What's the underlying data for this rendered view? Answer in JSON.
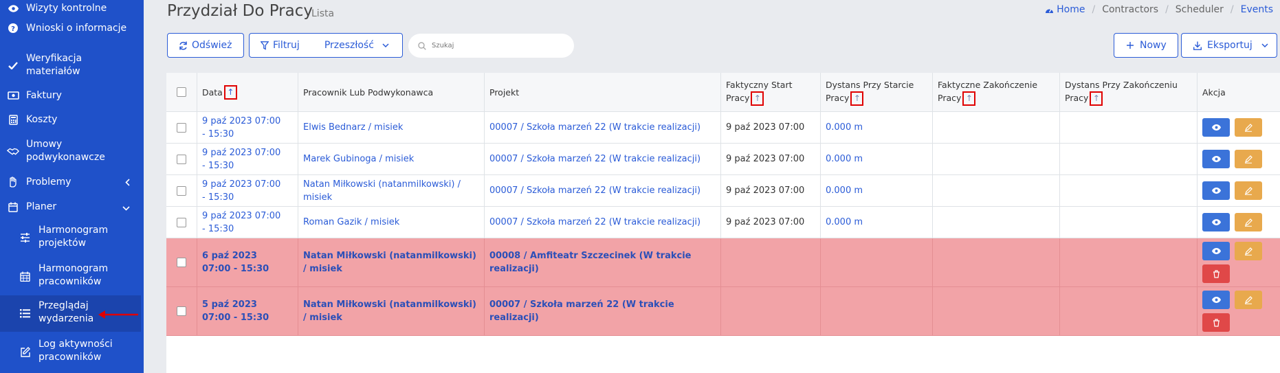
{
  "sidebar": {
    "items": [
      {
        "label": "Wizyty kontrolne",
        "icon": "eye-icon"
      },
      {
        "label": "Wnioski o informacje",
        "icon": "question-circle-icon"
      },
      {
        "label": "Weryfikacja materiałów",
        "icon": "check-icon"
      },
      {
        "label": "Faktury",
        "icon": "money-bill-icon"
      },
      {
        "label": "Koszty",
        "icon": "calculator-icon"
      },
      {
        "label": "Umowy podwykonawcze",
        "icon": "handshake-icon"
      },
      {
        "label": "Problemy",
        "icon": "hand-icon"
      },
      {
        "label": "Planer",
        "icon": "calendar-icon"
      },
      {
        "label": "Harmonogram projektów",
        "icon": "sliders-icon"
      },
      {
        "label": "Harmonogram pracowników",
        "icon": "calendar-grid-icon"
      },
      {
        "label": "Przeglądaj wydarzenia",
        "icon": "list-icon"
      },
      {
        "label": "Log aktywności pracowników",
        "icon": "edit-icon"
      }
    ]
  },
  "header": {
    "title": "Przydział Do Pracy",
    "subtitle": "Lista",
    "breadcrumbs": [
      "Home",
      "Contractors",
      "Scheduler",
      "Events"
    ]
  },
  "toolbar": {
    "refresh": "Odśwież",
    "filter": "Filtruj",
    "period": "Przeszłość",
    "search_placeholder": "Szukaj",
    "new": "Nowy",
    "export": "Eksportuj"
  },
  "table": {
    "columns": {
      "date": "Data",
      "worker": "Pracownik Lub Podwykonawca",
      "project": "Projekt",
      "actual_start": "Faktyczny Start Pracy",
      "start_distance": "Dystans Przy Starcie Pracy",
      "actual_end": "Faktyczne Zakończenie Pracy",
      "end_distance": "Dystans Przy Zakończeniu Pracy",
      "action": "Akcja"
    },
    "rows": [
      {
        "date": "9 paź 2023 07:00 - 15:30",
        "worker": "Elwis Bednarz / misiek",
        "project": "00007 / Szkoła marzeń 22 (W trakcie realizacji)",
        "actual_start": "9 paź 2023 07:00",
        "start_distance": "0.000 m",
        "actual_end": "",
        "end_distance": ""
      },
      {
        "date": "9 paź 2023 07:00 - 15:30",
        "worker": "Marek Gubinoga / misiek",
        "project": "00007 / Szkoła marzeń 22 (W trakcie realizacji)",
        "actual_start": "9 paź 2023 07:00",
        "start_distance": "0.000 m",
        "actual_end": "",
        "end_distance": ""
      },
      {
        "date": "9 paź 2023 07:00 - 15:30",
        "worker": "Natan Miłkowski (natanmilkowski) / misiek",
        "project": "00007 / Szkoła marzeń 22 (W trakcie realizacji)",
        "actual_start": "9 paź 2023 07:00",
        "start_distance": "0.000 m",
        "actual_end": "",
        "end_distance": ""
      },
      {
        "date": "9 paź 2023 07:00 - 15:30",
        "worker": "Roman Gazik / misiek",
        "project": "00007 / Szkoła marzeń 22 (W trakcie realizacji)",
        "actual_start": "9 paź 2023 07:00",
        "start_distance": "0.000 m",
        "actual_end": "",
        "end_distance": ""
      },
      {
        "date": "6 paź 2023 07:00 - 15:30",
        "worker": "Natan Miłkowski (natanmilkowski) / misiek",
        "project": "00008 / Amfiteatr Szczecinek (W trakcie realizacji)",
        "actual_start": "",
        "start_distance": "",
        "actual_end": "",
        "end_distance": ""
      },
      {
        "date": "5 paź 2023 07:00 - 15:30",
        "worker": "Natan Miłkowski (natanmilkowski) / misiek",
        "project": "00007 / Szkoła marzeń 22 (W trakcie realizacji)",
        "actual_start": "",
        "start_distance": "",
        "actual_end": "",
        "end_distance": ""
      }
    ]
  },
  "colors": {
    "sidebar": "#1f51c9",
    "primary": "#2a5bd7",
    "danger_row": "#f2a3a7",
    "view_button": "#3b73d9",
    "edit_button": "#e8a94d",
    "delete_button": "#e04848",
    "annotation": "#e00000"
  }
}
